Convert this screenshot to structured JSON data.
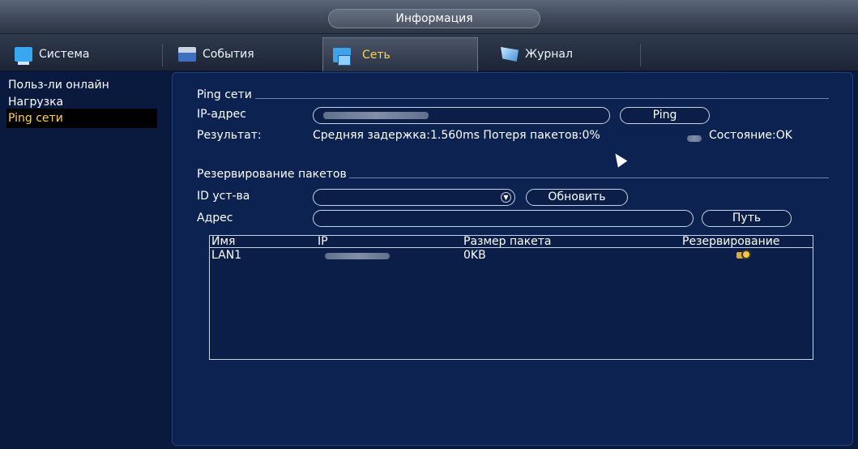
{
  "window": {
    "title": "Информация"
  },
  "tabs": [
    {
      "label": "Система",
      "icon": "monitor-icon"
    },
    {
      "label": "События",
      "icon": "events-icon"
    },
    {
      "label": "Сеть",
      "icon": "network-icon",
      "active": true
    },
    {
      "label": "Журнал",
      "icon": "log-icon"
    }
  ],
  "sidebar": {
    "items": [
      {
        "label": "Польз-ли онлайн"
      },
      {
        "label": "Нагрузка"
      },
      {
        "label": "Ping сети",
        "active": true
      }
    ]
  },
  "ping": {
    "section_title": "Ping сети",
    "ip_label": "IP-адрес",
    "ping_button": "Ping",
    "result_label": "Результат:",
    "result_text": "Средняя задержка:1.560ms  Потеря пакетов:0%",
    "state_text": "Состояние:OK"
  },
  "capture": {
    "section_title": "Резервирование пакетов",
    "device_label": "ID уст-ва",
    "refresh_button": "Обновить",
    "address_label": "Адрес",
    "path_button": "Путь",
    "columns": [
      "Имя",
      "IP",
      "Размер пакета",
      "Резервирование"
    ],
    "rows": [
      {
        "name": "LAN1",
        "size": "0KB",
        "backup_icon": "backup-icon"
      }
    ]
  },
  "colors": {
    "background": "#0a1a3f",
    "panel": "#0c2250",
    "active_text": "#ffd34a"
  }
}
